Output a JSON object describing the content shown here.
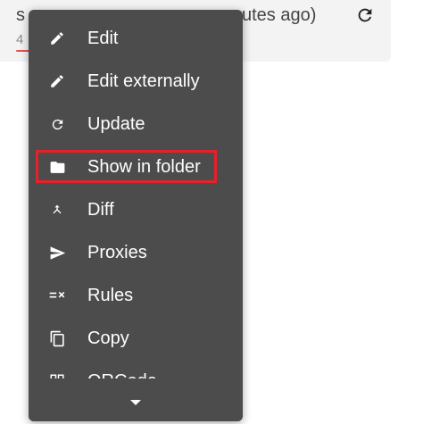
{
  "profile": {
    "title": "s",
    "time": "utes ago)",
    "usage": "4"
  },
  "context_menu": {
    "items": [
      {
        "label": "Edit",
        "icon": "pencil-icon"
      },
      {
        "label": "Edit externally",
        "icon": "pencil-icon"
      },
      {
        "label": "Update",
        "icon": "refresh-icon"
      },
      {
        "label": "Show in folder",
        "icon": "folder-icon"
      },
      {
        "label": "Diff",
        "icon": "merge-icon"
      },
      {
        "label": "Proxies",
        "icon": "send-icon"
      },
      {
        "label": "Rules",
        "icon": "rules-icon"
      },
      {
        "label": "Copy",
        "icon": "copy-icon"
      },
      {
        "label": "QRCode",
        "icon": "qrcode-icon"
      }
    ],
    "highlighted_item": "Show in folder",
    "highlight_color": "#e8202a",
    "background_color": "#4c4c4c"
  }
}
